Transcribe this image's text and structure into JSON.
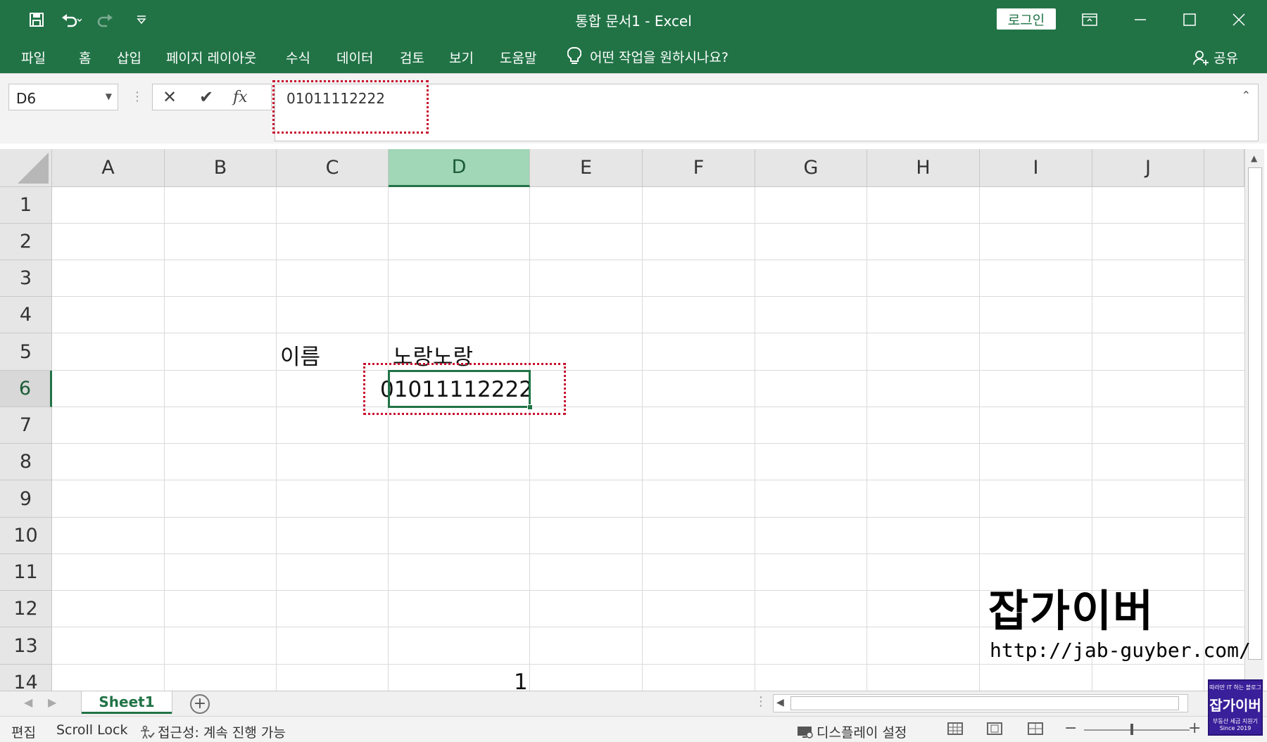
{
  "window": {
    "title": "통합 문서1  -  Excel",
    "login_label": "로그인"
  },
  "ribbon": {
    "tabs": [
      "파일",
      "홈",
      "삽입",
      "페이지 레이아웃",
      "수식",
      "데이터",
      "검토",
      "보기",
      "도움말"
    ],
    "tell_me": "어떤 작업을 원하시나요?",
    "share": "공유"
  },
  "formula_bar": {
    "name_box": "D6",
    "fx_label": "fx",
    "value": "01011112222"
  },
  "grid": {
    "columns": [
      "A",
      "B",
      "C",
      "D",
      "E",
      "F",
      "G",
      "H",
      "I",
      "J"
    ],
    "rows": [
      "1",
      "2",
      "3",
      "4",
      "5",
      "6",
      "7",
      "8",
      "9",
      "10",
      "11",
      "12",
      "13",
      "14"
    ],
    "active_column": "D",
    "active_row": "6",
    "cells": {
      "C5": "이름",
      "D5": "노랑노랑",
      "D6": "01011112222",
      "D14": "1"
    }
  },
  "sheets": {
    "tabs": [
      "Sheet1"
    ],
    "active": "Sheet1"
  },
  "status_bar": {
    "mode": "편집",
    "scroll_lock": "Scroll Lock",
    "accessibility": "접근성: 계속 진행 가능",
    "display_settings": "디스플레이 설정"
  },
  "watermark": {
    "title": "잡가이버",
    "url": "http://jab-guyber.com/",
    "logo_top": "따라만 IT 하는 블로그",
    "logo_main": "잡가이버",
    "logo_sub": "부동산 세금 지원기",
    "logo_since": "Since 2019"
  },
  "colors": {
    "excel_green": "#217346",
    "highlight_red": "#c8102e",
    "active_header": "#a1d6b7"
  },
  "icons": [
    "save-icon",
    "undo-icon",
    "redo-icon",
    "customize-icon",
    "ribbon-display-icon",
    "minimize-icon",
    "maximize-icon",
    "close-icon",
    "lightbulb-icon",
    "person-icon",
    "cancel-icon",
    "enter-icon",
    "fx-icon",
    "add-sheet-icon",
    "display-settings-icon",
    "normal-view-icon",
    "page-layout-icon",
    "page-break-icon"
  ]
}
